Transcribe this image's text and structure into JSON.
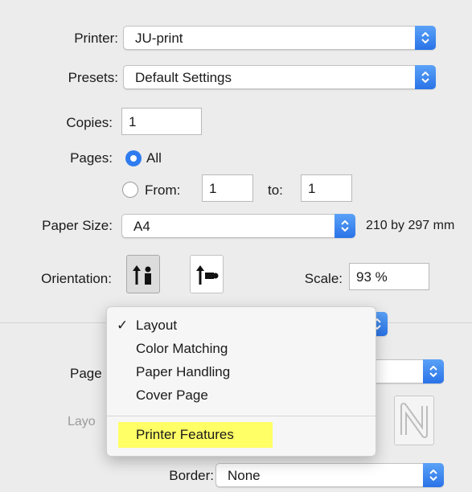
{
  "printer": {
    "label": "Printer:",
    "value": "JU-print"
  },
  "presets": {
    "label": "Presets:",
    "value": "Default Settings"
  },
  "copies": {
    "label": "Copies:",
    "value": "1"
  },
  "pages": {
    "label": "Pages:",
    "all_label": "All",
    "from_label": "From:",
    "from_value": "1",
    "to_label": "to:",
    "to_value": "1",
    "selected": "All"
  },
  "paper_size": {
    "label": "Paper Size:",
    "value": "A4",
    "dimensions": "210 by 297 mm"
  },
  "orientation": {
    "label": "Orientation:",
    "selected": "portrait"
  },
  "scale": {
    "label": "Scale:",
    "value": "93 %"
  },
  "section_menu": {
    "checked": "Layout",
    "checkmark": "✓",
    "items": [
      "Layout",
      "Color Matching",
      "Paper Handling",
      "Cover Page"
    ],
    "extra_item": "Printer Features",
    "highlight_color": "#ffff66"
  },
  "background_labels": {
    "page_partial": "Page",
    "layout_partial": "Layo"
  },
  "border": {
    "label": "Border:",
    "value": "None"
  },
  "colors": {
    "accent": "#2f7cf0"
  }
}
